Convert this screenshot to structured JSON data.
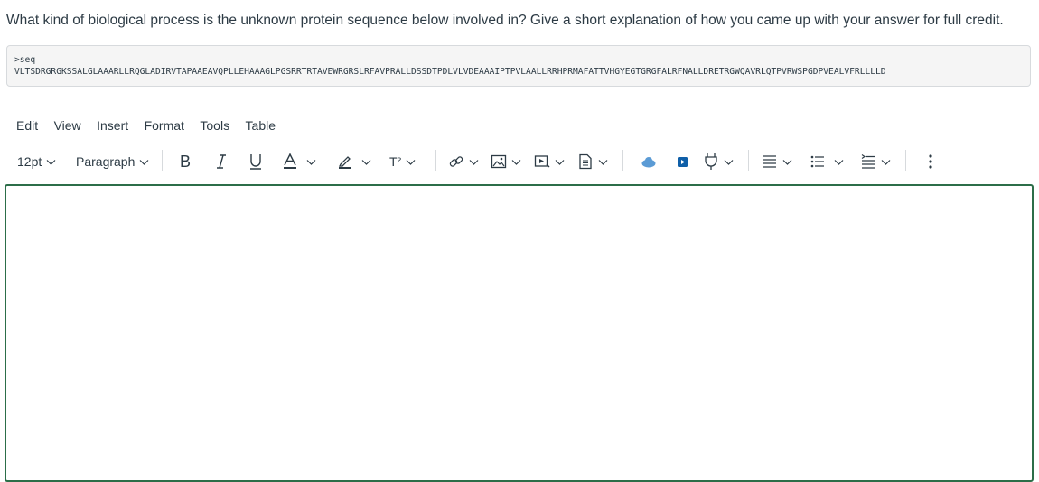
{
  "question": {
    "text": "What kind of biological process is the unknown protein sequence below involved in? Give a short explanation of how you came up with your answer for full credit."
  },
  "sequence": {
    "header": ">seq",
    "residues": "VLTSDRGRGKSSALGLAAARLLRQGLADIRVTAPAAEAVQPLLEHAAAGLPGSRRTRTAVEWRGRSLRFAVPRALLDSSDTPDLVLVDEAAAIPTPVLAALLRRHPRMAFATTVHGYEGTGRGFALRFNALLDRETRGWQAVRLQTPVRWSPGDPVEALVFRLLLLD"
  },
  "menubar": {
    "items": [
      "Edit",
      "View",
      "Insert",
      "Format",
      "Tools",
      "Table"
    ]
  },
  "toolbar": {
    "font_size": "12pt",
    "block_format": "Paragraph",
    "superscript_glyph": "T²",
    "icons": [
      "bold-icon",
      "italic-icon",
      "underline-icon",
      "text-color-icon",
      "highlight-icon",
      "superscript-icon",
      "link-icon",
      "image-icon",
      "media-icon",
      "document-icon",
      "cloud-icon",
      "media-player-icon",
      "plugin-icon",
      "align-icon",
      "list-icon",
      "indent-icon",
      "more-icon"
    ]
  },
  "colors": {
    "editor_border": "#2c6e49",
    "text": "#2d3b45",
    "seq_background": "#f5f5f5",
    "cloud": "#5b9bd5",
    "media_player": "#0f5fa8"
  }
}
